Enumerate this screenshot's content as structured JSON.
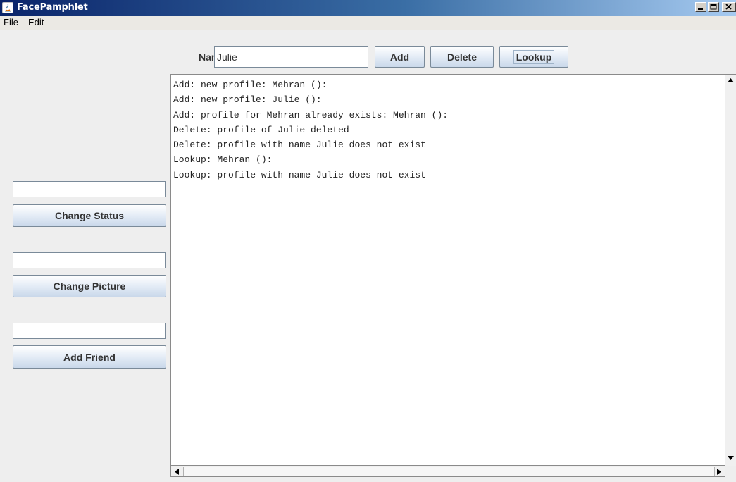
{
  "window": {
    "title": "FacePamphlet"
  },
  "menu": {
    "items": [
      "File",
      "Edit"
    ]
  },
  "topbar": {
    "name_label": "Name",
    "name_value": "Julie",
    "add_label": "Add",
    "delete_label": "Delete",
    "lookup_label": "Lookup"
  },
  "sidebar": {
    "status_input": "",
    "status_button": "Change Status",
    "picture_input": "",
    "picture_button": "Change Picture",
    "friend_input": "",
    "friend_button": "Add Friend"
  },
  "log": {
    "lines": [
      "Add: new profile: Mehran ():",
      "Add: new profile: Julie ():",
      "Add: profile for Mehran already exists: Mehran ():",
      "Delete: profile of Julie deleted",
      "Delete: profile with name Julie does not exist",
      "Lookup: Mehran ():",
      "Lookup: profile with name Julie does not exist"
    ]
  },
  "colors": {
    "titlebar_start": "#0a246a",
    "titlebar_end": "#a6caf0",
    "button_face": "#e4ecf6",
    "button_text": "#333333"
  }
}
